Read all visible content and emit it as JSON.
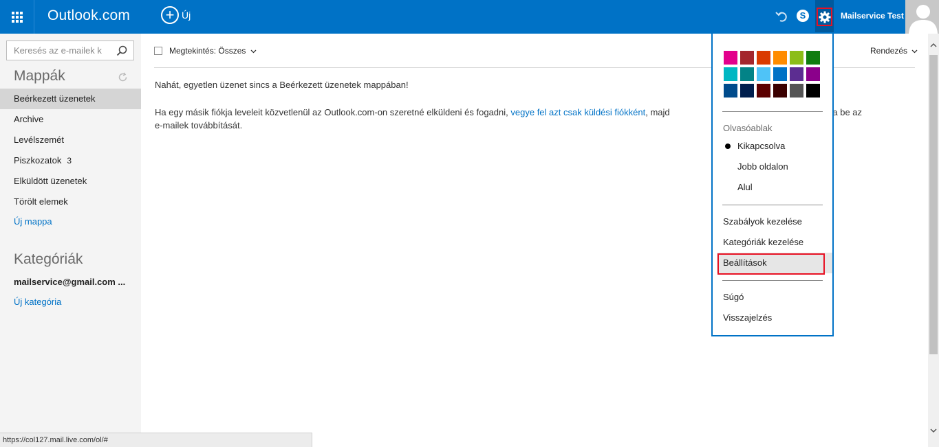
{
  "header": {
    "brand": "Outlook.com",
    "new_label": "Új",
    "username": "Mailservice Test"
  },
  "sidebar": {
    "search_placeholder": "Keresés az e-mailek k",
    "folders_title": "Mappák",
    "folders": [
      {
        "label": "Beérkezett üzenetek"
      },
      {
        "label": "Archive"
      },
      {
        "label": "Levélszemét"
      },
      {
        "label": "Piszkozatok",
        "count": "3"
      },
      {
        "label": "Elküldött üzenetek"
      },
      {
        "label": "Törölt elemek"
      }
    ],
    "new_folder": "Új mappa",
    "categories_title": "Kategóriák",
    "category_account": "mailservice@gmail.com ...",
    "new_category": "Új kategória"
  },
  "main": {
    "filter_label": "Megtekintés: Összes",
    "sort_label": "Rendezés",
    "empty_message": "Nahát, egyetlen üzenet sincs a Beérkezett üzenetek mappában!",
    "hint_prefix": "Ha  egy másik fiókja leveleit közvetlenül az Outlook.com-on szeretné elküldeni és fogadni, ",
    "hint_link": "vegye fel azt csak küldési fiókként",
    "hint_middle": ", majd",
    "hint_tail": "ba, és állítsa be az",
    "hint_line2": "e-mailek továbbítását."
  },
  "dropdown": {
    "colors": [
      "#e3008c",
      "#a4262c",
      "#da3b01",
      "#ff8c00",
      "#8cbd18",
      "#107c10",
      "#00b7c3",
      "#038387",
      "#4fc3f7",
      "#0072c6",
      "#5c2d91",
      "#8b008b",
      "#004b8c",
      "#001f4e",
      "#5c0000",
      "#3b0000",
      "#555555",
      "#000000"
    ],
    "reading_pane_heading": "Olvasóablak",
    "reading_options": [
      "Kikapcsolva",
      "Jobb oldalon",
      "Alul"
    ],
    "manage_rules": "Szabályok kezelése",
    "manage_categories": "Kategóriák kezelése",
    "settings": "Beállítások",
    "help": "Súgó",
    "feedback": "Visszajelzés"
  },
  "status_url": "https://col127.mail.live.com/ol/#"
}
